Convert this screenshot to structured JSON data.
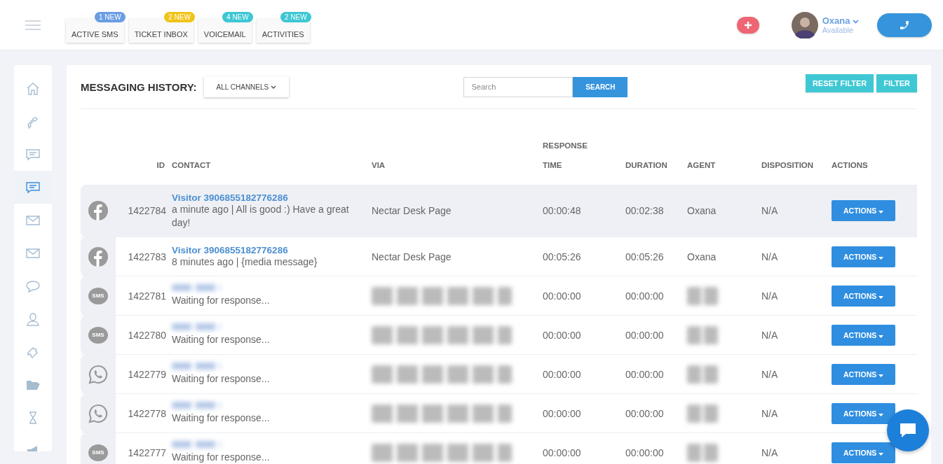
{
  "topbar": {
    "tabs": [
      {
        "label": "ACTIVE SMS",
        "badge": "1 NEW",
        "color": "#6a9de3"
      },
      {
        "label": "TICKET INBOX",
        "badge": "2 NEW",
        "color": "#f0c418"
      },
      {
        "label": "VOICEMAIL",
        "badge": "4 NEW",
        "color": "#3cc7d3"
      },
      {
        "label": "ACTIVITIES",
        "badge": "2 NEW",
        "color": "#3cc7d3"
      }
    ],
    "user": {
      "name": "Oxana",
      "status": "Available"
    }
  },
  "sidebar": {
    "items": [
      {
        "kind": "home",
        "selected": false
      },
      {
        "kind": "phone",
        "selected": false
      },
      {
        "kind": "chat",
        "selected": false
      },
      {
        "kind": "chat",
        "selected": true
      },
      {
        "kind": "mail",
        "selected": false
      },
      {
        "kind": "mail",
        "selected": false
      },
      {
        "kind": "bubble",
        "selected": false
      },
      {
        "kind": "user",
        "selected": false
      },
      {
        "kind": "puzzle",
        "selected": false
      },
      {
        "kind": "folder",
        "selected": false
      },
      {
        "kind": "hourglass",
        "selected": false
      },
      {
        "kind": "megaphone",
        "selected": false
      }
    ]
  },
  "header": {
    "title": "MESSAGING HISTORY:",
    "channel_filter": "ALL CHANNELS",
    "search": {
      "placeholder": "Search",
      "button": "SEARCH"
    },
    "buttons": [
      "RESET FILTER",
      "FILTER"
    ]
  },
  "table": {
    "columns": [
      {
        "label": "ID"
      },
      {
        "label": "CONTACT"
      },
      {
        "label": "VIA"
      },
      {
        "label": "TIME",
        "overline": "RESPONSE"
      },
      {
        "label": "DURATION"
      },
      {
        "label": "AGENT"
      },
      {
        "label": "DISPOSITION"
      },
      {
        "label": "ACTIONS"
      }
    ],
    "rows": [
      {
        "selected": true,
        "kind": "facebook",
        "id": "1422784",
        "redacted": false,
        "name": "Visitor 3906855182776286",
        "message": "a minute ago | All is good :) Have a great day!",
        "via": "Nectar Desk Page",
        "time": "00:00:48",
        "duration": "00:02:38",
        "agent": "Oxana",
        "disposition": "N/A",
        "action": "ACTIONS"
      },
      {
        "selected": false,
        "kind": "facebook",
        "id": "1422783",
        "redacted": false,
        "name": "Visitor 3906855182776286",
        "message": "8 minutes ago | {media message}",
        "via": "Nectar Desk Page",
        "time": "00:05:26",
        "duration": "00:05:26",
        "agent": "Oxana",
        "disposition": "N/A",
        "action": "ACTIONS"
      },
      {
        "selected": false,
        "kind": "sms",
        "channel_label": "SMS",
        "id": "1422781",
        "redacted": true,
        "message": "Waiting for response...",
        "time": "00:00:00",
        "duration": "00:00:00",
        "disposition": "N/A",
        "action": "ACTIONS"
      },
      {
        "selected": false,
        "kind": "sms",
        "channel_label": "SMS",
        "id": "1422780",
        "redacted": true,
        "message": "Waiting for response...",
        "time": "00:00:00",
        "duration": "00:00:00",
        "disposition": "N/A",
        "action": "ACTIONS"
      },
      {
        "selected": false,
        "kind": "whatsapp",
        "id": "1422779",
        "redacted": true,
        "message": "Waiting for response...",
        "time": "00:00:00",
        "duration": "00:00:00",
        "disposition": "N/A",
        "action": "ACTIONS"
      },
      {
        "selected": false,
        "kind": "whatsapp",
        "id": "1422778",
        "redacted": true,
        "message": "Waiting for response...",
        "time": "00:00:00",
        "duration": "00:00:00",
        "disposition": "N/A",
        "action": "ACTIONS"
      },
      {
        "selected": false,
        "kind": "sms",
        "channel_label": "SMS",
        "id": "1422777",
        "redacted": true,
        "message": "Waiting for response...",
        "time": "00:00:00",
        "duration": "00:00:00",
        "disposition": "N/A",
        "action": "ACTIONS"
      }
    ]
  }
}
